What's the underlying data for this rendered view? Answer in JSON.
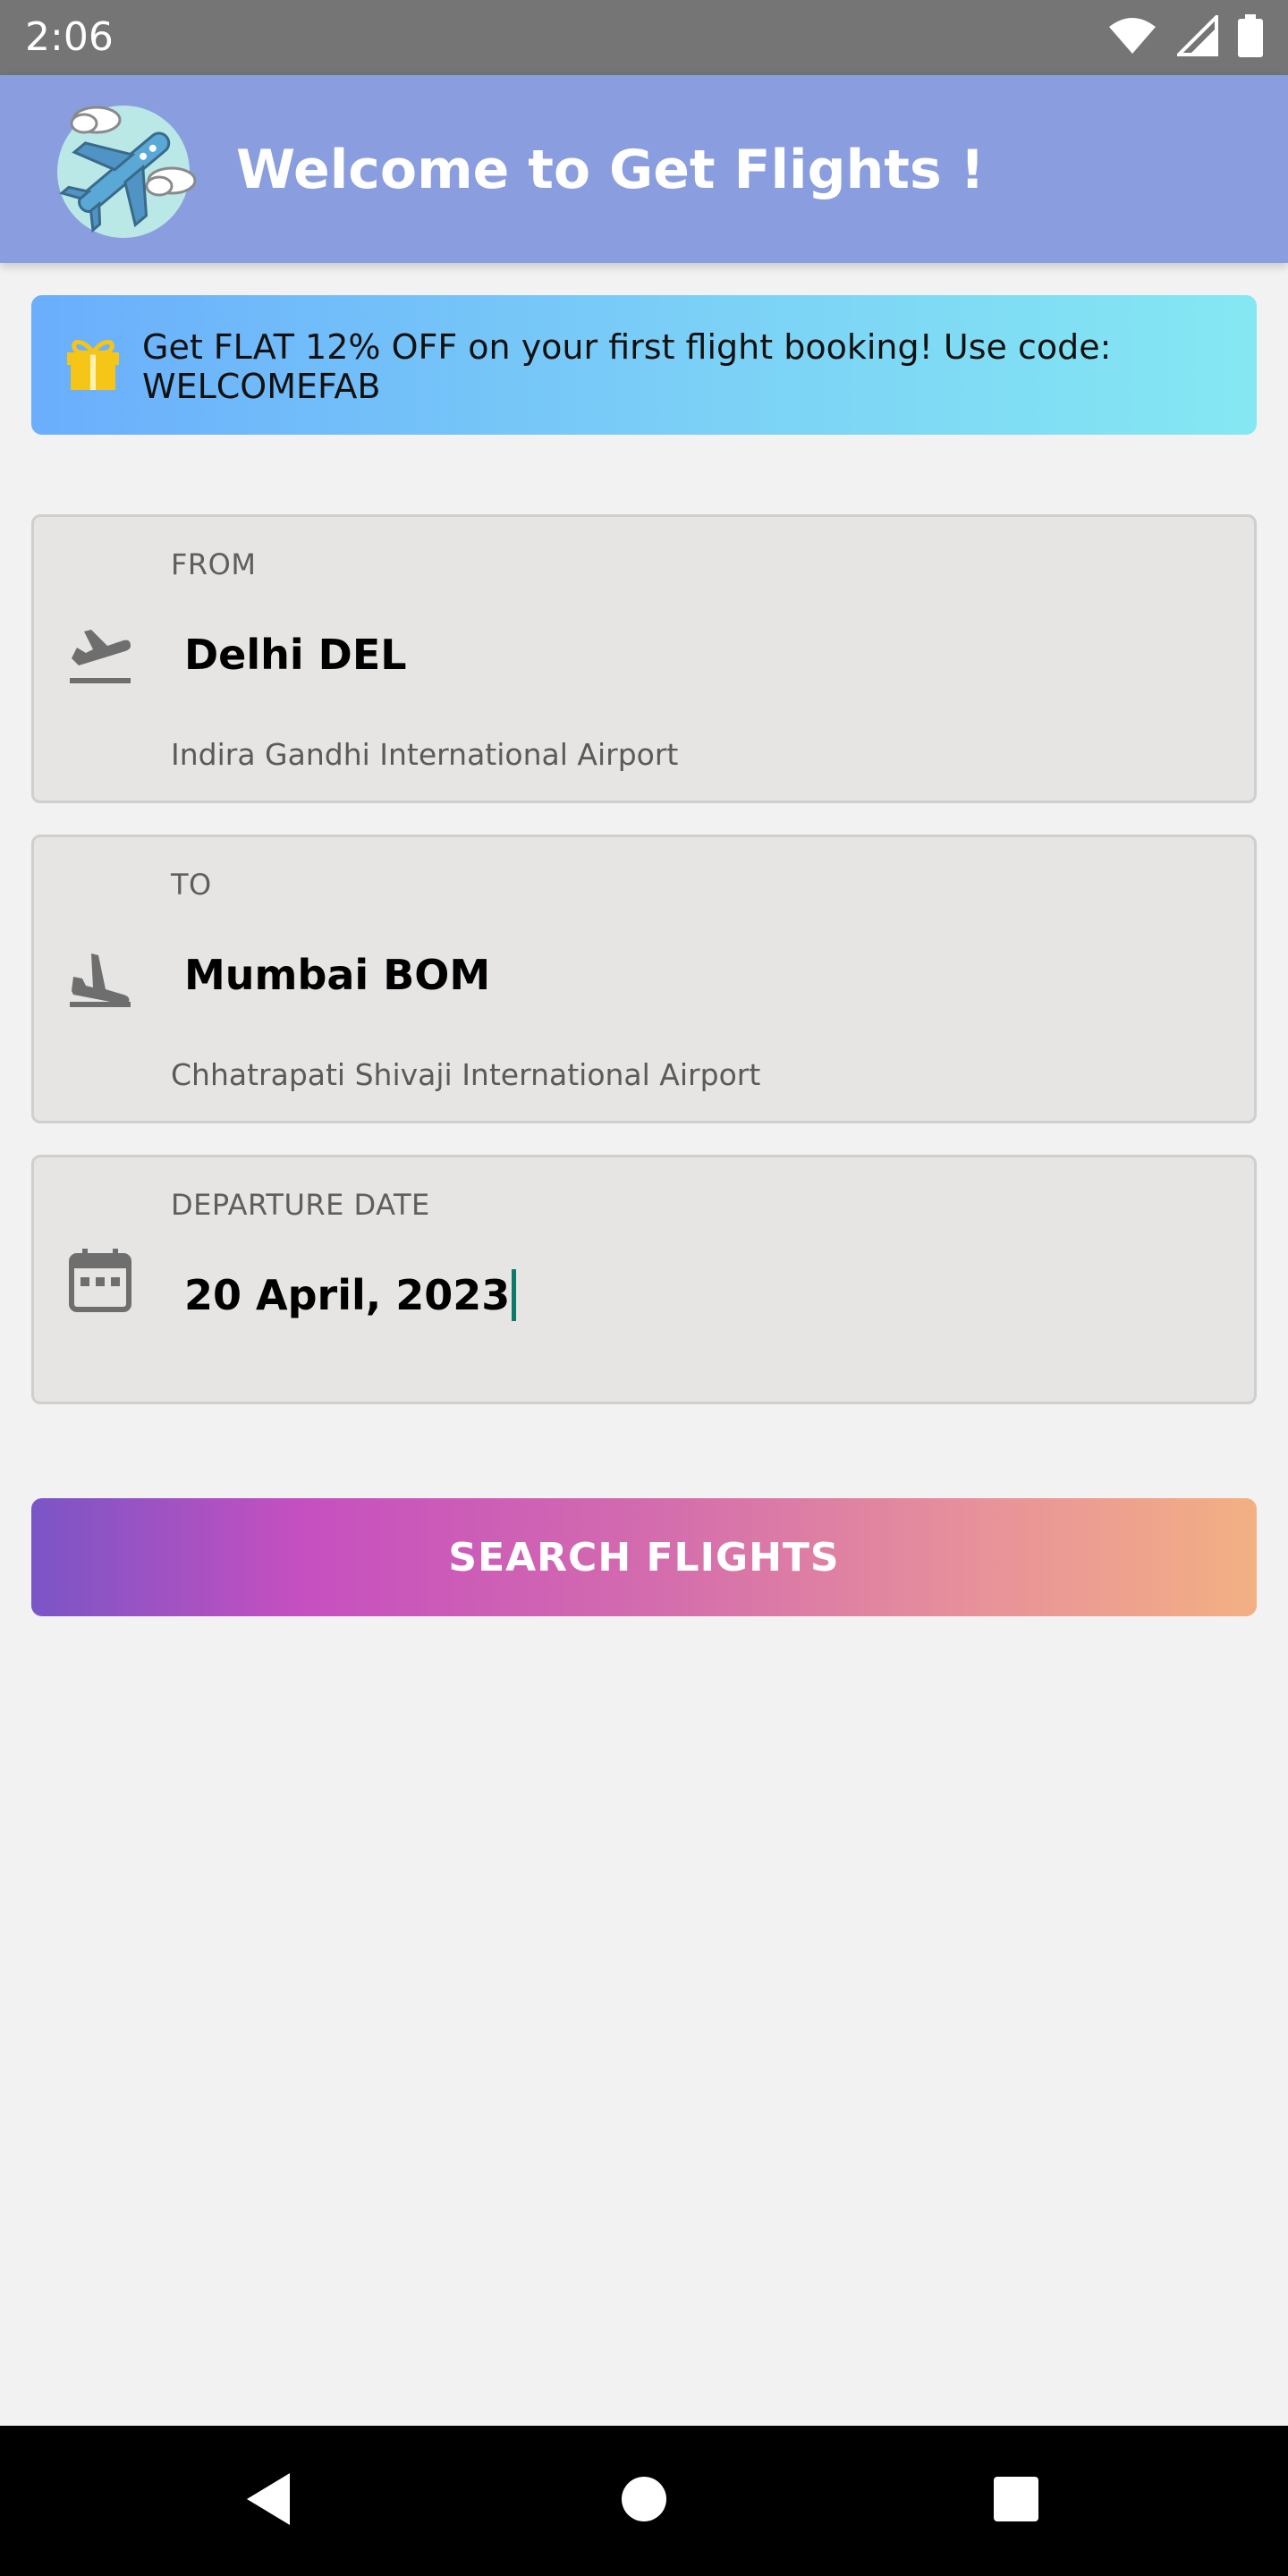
{
  "status_bar": {
    "time": "2:06",
    "icons": [
      "wifi-icon",
      "cell-signal-icon",
      "battery-icon"
    ]
  },
  "app_bar": {
    "title": "Welcome to Get Flights !",
    "logo_icon": "airplane-clouds-logo"
  },
  "promo": {
    "icon": "gift-icon",
    "text": "Get FLAT 12% OFF on your first flight booking! Use code: WELCOMEFAB"
  },
  "from": {
    "label": "FROM",
    "value": "Delhi DEL",
    "airport": "Indira Gandhi International Airport",
    "icon": "flight-takeoff-icon"
  },
  "to": {
    "label": "TO",
    "value": "Mumbai BOM",
    "airport": "Chhatrapati Shivaji International Airport",
    "icon": "flight-land-icon"
  },
  "departure": {
    "label": "DEPARTURE DATE",
    "value": "20 April, 2023",
    "icon": "calendar-icon"
  },
  "search_button": {
    "label": "SEARCH FLIGHTS"
  },
  "nav_bar": {
    "buttons": [
      "back-icon",
      "home-icon",
      "recents-icon"
    ]
  },
  "colors": {
    "app_bar": "#8a9edf",
    "status_bar": "#757575",
    "background": "#f2f2f2",
    "card": "#e6e5e3",
    "caret": "#0a7a6c",
    "gift": "#f5c518"
  }
}
